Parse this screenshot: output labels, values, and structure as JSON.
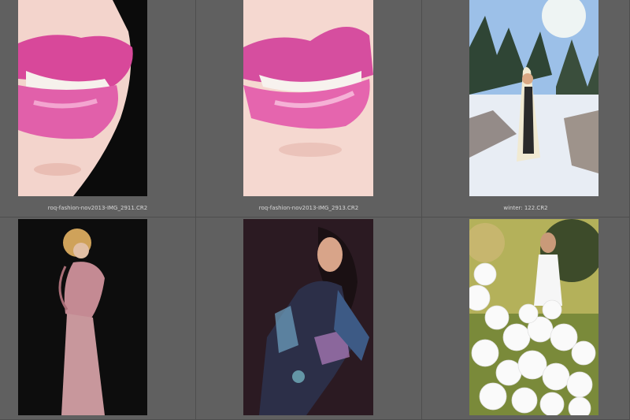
{
  "thumbnails": [
    {
      "filename": "roq-fashion-nov2013-IMG_2911.CR2",
      "subject": "lips-closeup-side"
    },
    {
      "filename": "roq-fashion-nov2013-IMG_2913.CR2",
      "subject": "lips-closeup-front"
    },
    {
      "filename": "winter: 122.CR2",
      "subject": "woman-white-cloak-snowy-forest"
    },
    {
      "filename": "",
      "subject": "woman-pink-gown-black-background"
    },
    {
      "filename": "",
      "subject": "woman-patterned-top-dark-background"
    },
    {
      "filename": "",
      "subject": "woman-balloon-dress-outdoors"
    }
  ],
  "colors": {
    "grid_background": "#5f5f5f",
    "caption_text": "#d8d8d8",
    "lipstick_pink": "#e05aa8"
  }
}
